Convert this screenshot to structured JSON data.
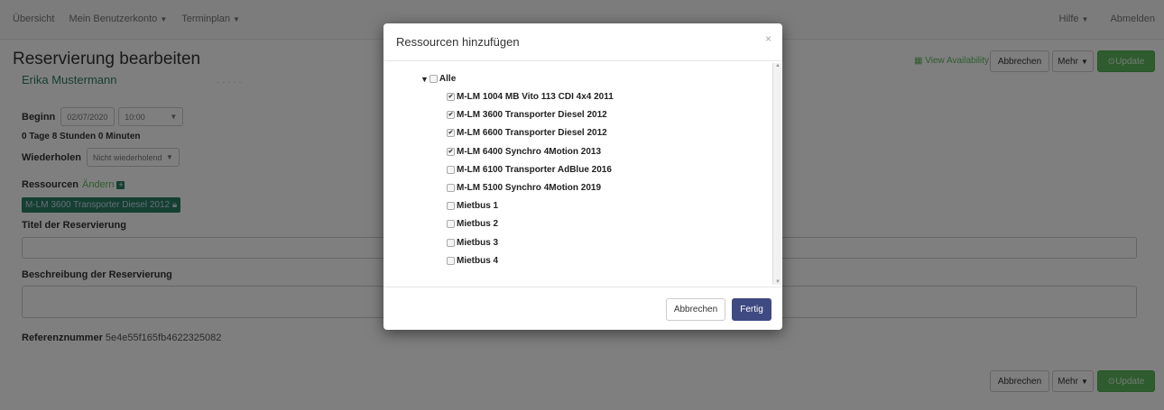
{
  "nav": {
    "left": [
      "Übersicht",
      "Mein Benutzerkonto",
      "Terminplan"
    ],
    "left_has_caret": [
      false,
      true,
      true
    ],
    "right": [
      "Hilfe",
      "Abmelden"
    ],
    "right_has_caret": [
      true,
      false
    ]
  },
  "page": {
    "title": "Reservierung bearbeiten",
    "user_name": "Erika Mustermann",
    "user_extra": "· · ·  · ·"
  },
  "form": {
    "begin_label": "Beginn",
    "begin_date": "02/07/2020",
    "begin_time": "10:00",
    "duration": "0 Tage 8 Stunden 0 Minuten",
    "repeat_label": "Wiederholen",
    "repeat_value": "Nicht wiederholend",
    "resources_label": "Ressourcen",
    "resources_change": "Ändern",
    "resource_tag": "M-LM 3600 Transporter Diesel 2012",
    "title_label": "Titel der Reservierung",
    "description_label": "Beschreibung der Reservierung",
    "reference_label": "Referenznummer",
    "reference_value": "5e4e55f165fb4622325082"
  },
  "actions": {
    "availability": "View Availability",
    "cancel": "Abbrechen",
    "more": "Mehr",
    "update": "Update"
  },
  "modal": {
    "title": "Ressourcen hinzufügen",
    "close": "×",
    "root_label": "Alle",
    "root_checked": false,
    "items": [
      {
        "label": "M-LM 1004 MB Vito 113 CDI 4x4 2011",
        "checked": true
      },
      {
        "label": "M-LM 3600 Transporter Diesel 2012",
        "checked": true
      },
      {
        "label": "M-LM 6600 Transporter Diesel 2012",
        "checked": true
      },
      {
        "label": "M-LM 6400 Synchro 4Motion 2013",
        "checked": true
      },
      {
        "label": "M-LM 6100 Transporter AdBlue 2016",
        "checked": false
      },
      {
        "label": "M-LM 5100 Synchro 4Motion 2019",
        "checked": false
      },
      {
        "label": "Mietbus 1",
        "checked": false
      },
      {
        "label": "Mietbus 2",
        "checked": false
      },
      {
        "label": "Mietbus 3",
        "checked": false
      },
      {
        "label": "Mietbus 4",
        "checked": false
      }
    ],
    "cancel": "Abbrechen",
    "done": "Fertig"
  },
  "colors": {
    "accent_green": "#5cb85c",
    "resource_tag": "#2a7f62",
    "primary_modal_button": "#3f4a82",
    "overlay": "rgba(0,0,0,0.5)"
  },
  "icons": [
    "calendar-icon",
    "plus-square-icon",
    "lock-icon",
    "check-circle-icon",
    "caret-down-icon",
    "close-icon",
    "triangle-down-icon",
    "checkbox-icon"
  ]
}
